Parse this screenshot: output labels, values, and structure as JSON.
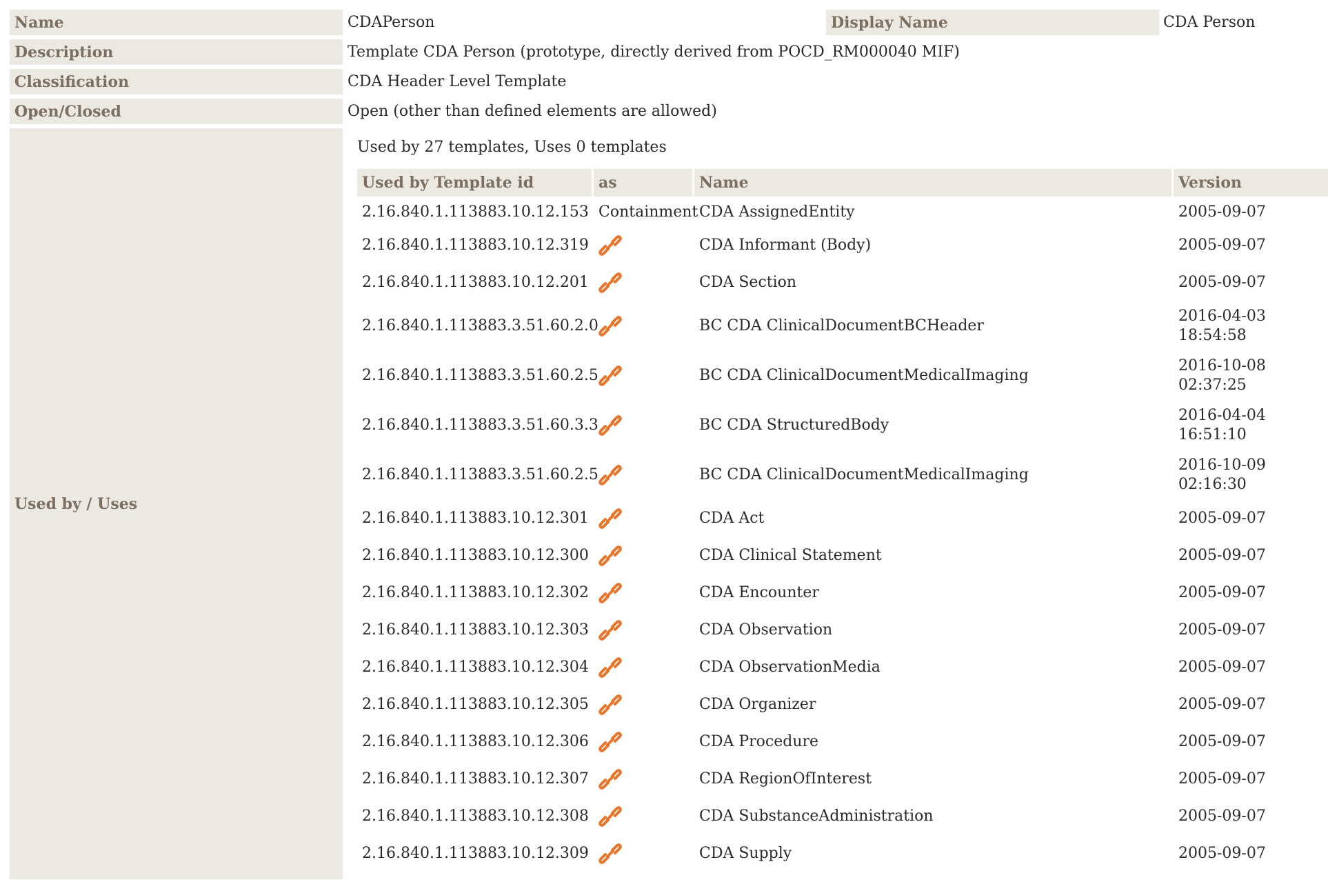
{
  "fields": {
    "name": {
      "label": "Name",
      "value": "CDAPerson"
    },
    "display_name": {
      "label": "Display Name",
      "value": "CDA Person"
    },
    "description": {
      "label": "Description",
      "value": "Template CDA Person (prototype, directly derived from POCD_RM000040 MIF)"
    },
    "classification": {
      "label": "Classification",
      "value": "CDA Header Level Template"
    },
    "open_closed": {
      "label": "Open/Closed",
      "value": "Open (other than defined elements are allowed)"
    },
    "used_by_uses": {
      "label": "Used by / Uses"
    }
  },
  "usage": {
    "summary": "Used by 27 templates, Uses 0 templates",
    "columns": [
      "Used by Template id",
      "as",
      "Name",
      "Version"
    ],
    "rows": [
      {
        "id": "2.16.840.1.113883.10.12.153",
        "as": "Containment",
        "name": "CDA AssignedEntity",
        "version": [
          "2005-09-07"
        ]
      },
      {
        "id": "2.16.840.1.113883.10.12.319",
        "as": "link-icon",
        "name": "CDA Informant (Body)",
        "version": [
          "2005-09-07"
        ]
      },
      {
        "id": "2.16.840.1.113883.10.12.201",
        "as": "link-icon",
        "name": "CDA Section",
        "version": [
          "2005-09-07"
        ]
      },
      {
        "id": "2.16.840.1.113883.3.51.60.2.0",
        "as": "link-icon",
        "name": "BC CDA ClinicalDocumentBCHeader",
        "version": [
          "2016-04-03",
          "18:54:58"
        ]
      },
      {
        "id": "2.16.840.1.113883.3.51.60.2.5",
        "as": "link-icon",
        "name": "BC CDA ClinicalDocumentMedicalImaging",
        "version": [
          "2016-10-08",
          "02:37:25"
        ]
      },
      {
        "id": "2.16.840.1.113883.3.51.60.3.3",
        "as": "link-icon",
        "name": "BC CDA StructuredBody",
        "version": [
          "2016-04-04",
          "16:51:10"
        ]
      },
      {
        "id": "2.16.840.1.113883.3.51.60.2.5",
        "as": "link-icon",
        "name": "BC CDA ClinicalDocumentMedicalImaging",
        "version": [
          "2016-10-09",
          "02:16:30"
        ]
      },
      {
        "id": "2.16.840.1.113883.10.12.301",
        "as": "link-icon",
        "name": "CDA Act",
        "version": [
          "2005-09-07"
        ]
      },
      {
        "id": "2.16.840.1.113883.10.12.300",
        "as": "link-icon",
        "name": "CDA Clinical Statement",
        "version": [
          "2005-09-07"
        ]
      },
      {
        "id": "2.16.840.1.113883.10.12.302",
        "as": "link-icon",
        "name": "CDA Encounter",
        "version": [
          "2005-09-07"
        ]
      },
      {
        "id": "2.16.840.1.113883.10.12.303",
        "as": "link-icon",
        "name": "CDA Observation",
        "version": [
          "2005-09-07"
        ]
      },
      {
        "id": "2.16.840.1.113883.10.12.304",
        "as": "link-icon",
        "name": "CDA ObservationMedia",
        "version": [
          "2005-09-07"
        ]
      },
      {
        "id": "2.16.840.1.113883.10.12.305",
        "as": "link-icon",
        "name": "CDA Organizer",
        "version": [
          "2005-09-07"
        ]
      },
      {
        "id": "2.16.840.1.113883.10.12.306",
        "as": "link-icon",
        "name": "CDA Procedure",
        "version": [
          "2005-09-07"
        ]
      },
      {
        "id": "2.16.840.1.113883.10.12.307",
        "as": "link-icon",
        "name": "CDA RegionOfInterest",
        "version": [
          "2005-09-07"
        ]
      },
      {
        "id": "2.16.840.1.113883.10.12.308",
        "as": "link-icon",
        "name": "CDA SubstanceAdministration",
        "version": [
          "2005-09-07"
        ]
      },
      {
        "id": "2.16.840.1.113883.10.12.309",
        "as": "link-icon",
        "name": "CDA Supply",
        "version": [
          "2005-09-07"
        ]
      }
    ]
  },
  "colors": {
    "label_bg": "#ece9e3",
    "label_text": "#7c6f60",
    "link_icon": "#e8742a"
  }
}
